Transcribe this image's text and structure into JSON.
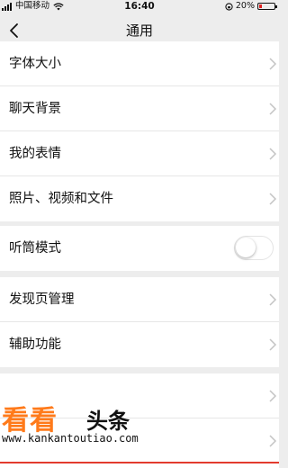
{
  "status_bar": {
    "carrier": "中国移动",
    "time": "16:40",
    "battery_text": "20%",
    "battery_level": 0.2
  },
  "nav": {
    "title": "通用",
    "back_icon": "chevron-left-icon"
  },
  "groups": [
    {
      "rows": [
        {
          "label": "字体大小",
          "type": "link"
        },
        {
          "label": "聊天背景",
          "type": "link"
        },
        {
          "label": "我的表情",
          "type": "link"
        },
        {
          "label": "照片、视频和文件",
          "type": "link"
        }
      ]
    },
    {
      "rows": [
        {
          "label": "听筒模式",
          "type": "toggle",
          "on": false
        }
      ]
    },
    {
      "rows": [
        {
          "label": "发现页管理",
          "type": "link"
        },
        {
          "label": "辅助功能",
          "type": "link"
        }
      ]
    }
  ],
  "watermark": {
    "brand_main": "看看",
    "brand_sub": "头条",
    "url": "www.kankantoutiao.com"
  },
  "colors": {
    "background": "#ededed",
    "row_bg": "#ffffff",
    "battery_low": "#e02020",
    "watermark_orange": "#ff7a1a",
    "watermark_line": "#e23b2e"
  }
}
